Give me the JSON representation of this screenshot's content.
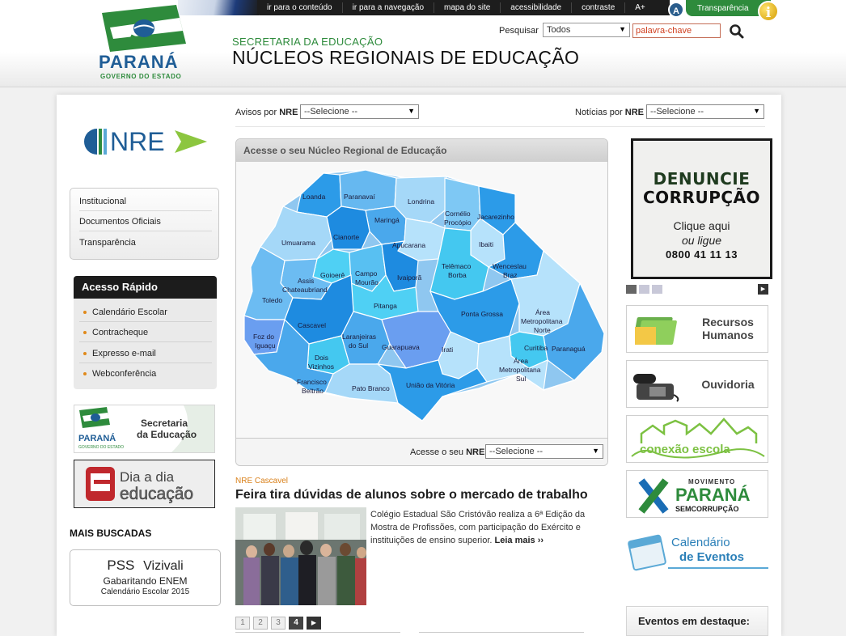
{
  "topbar": {
    "links": [
      "ir para o conteúdo",
      "ir para a navegação",
      "mapa do site",
      "acessibilidade",
      "contraste",
      "A+"
    ],
    "transparencia": "Transparência",
    "accessibility_icon_letter": "A",
    "info_icon_letter": "i"
  },
  "logo": {
    "word": "PARANÁ",
    "sub": "GOVERNO DO ESTADO"
  },
  "header": {
    "secretaria": "SECRETARIA DA EDUCAÇÃO",
    "title": "NÚCLEOS REGIONAIS DE EDUCAÇÃO",
    "search_label": "Pesquisar",
    "search_select": "Todos",
    "search_placeholder": "palavra-chave"
  },
  "sidebar": {
    "nre_logo_text": "NRE",
    "nav": [
      "Institucional",
      "Documentos Oficiais",
      "Transparência"
    ],
    "quick_access_title": "Acesso Rápido",
    "quick_access": [
      "Calendário Escolar",
      "Contracheque",
      "Expresso e-mail",
      "Webconferência"
    ],
    "banner_sec": {
      "brand": "PARANÁ",
      "sub": "GOVERNO DO ESTADO",
      "line1": "Secretaria",
      "line2": "da Educação"
    },
    "banner_dia": {
      "line1": "Dia a dia",
      "line2": "educação"
    },
    "mais_buscadas_title": "MAIS BUSCADAS",
    "mais_buscadas": {
      "pss": "PSS",
      "vizivali": "Vizivali",
      "gabaritando": "Gabaritando ENEM",
      "calendario": "Calendário Escolar 2015"
    }
  },
  "filters": {
    "avisos_label": "Avisos por ",
    "avisos_bold": "NRE",
    "noticias_label": "Notícias por ",
    "noticias_bold": "NRE",
    "select_default": "--Selecione --"
  },
  "map": {
    "title": "Acesse o seu Núcleo Regional de Educação",
    "footer_label": "Acesse o seu ",
    "footer_bold": "NRE",
    "footer_select": "--Selecione --",
    "regions": {
      "loanda": "Loanda",
      "paranavai": "Paranavaí",
      "londrina": "Londrina",
      "cornelio1": "Cornélio",
      "cornelio2": "Procópio",
      "jacarezinho": "Jacarezinho",
      "maringa": "Maringá",
      "umuarama": "Umuarama",
      "cianorte": "Cianorte",
      "apucarana": "Apucarana",
      "ibaiti": "Ibaiti",
      "goioere": "Goioerê",
      "campo1": "Campo",
      "campo2": "Mourão",
      "assis1": "Assis",
      "assis2": "Chateaubriand",
      "ivaipora": "Ivaiporã",
      "telemaco1": "Telêmaco",
      "telemaco2": "Borba",
      "wenceslau1": "Wenceslau",
      "wenceslau2": "Braz",
      "toledo": "Toledo",
      "pitanga": "Pitanga",
      "pontagrossa": "Ponta Grossa",
      "amn1": "Área",
      "amn2": "Metropolitana",
      "amn3": "Norte",
      "cascavel": "Cascavel",
      "foz1": "Foz do",
      "foz2": "Iguaçu",
      "laranjeiras1": "Laranjeiras",
      "laranjeiras2": "do Sul",
      "guarapuava": "Guarapuava",
      "irati": "Irati",
      "curitiba": "Curitiba",
      "paranagua": "Paranaguá",
      "dois1": "Dois",
      "dois2": "Vizinhos",
      "ams1": "Área",
      "ams2": "Metropolitana",
      "ams3": "Sul",
      "francisco1": "Francisco",
      "francisco2": "Beltrão",
      "patobranco": "Pato Branco",
      "uniao": "União da Vitória"
    }
  },
  "news": {
    "category": "NRE Cascavel",
    "title": "Feira tira dúvidas de alunos sobre o mercado de trabalho",
    "text": "Colégio Estadual São Cristóvão realiza a 6ª Edição da Mostra de Profissões, com participação do Exército e instituições de ensino superior.",
    "more": "Leia mais ››",
    "pages": [
      "1",
      "2",
      "3",
      "4"
    ],
    "next": "▶"
  },
  "right": {
    "denuncie": {
      "line1": "DENUNCIE",
      "line2": "CORRUPÇÃO",
      "line3": "Clique aqui",
      "line4": "ou ligue",
      "phone": "0800 41 11 13"
    },
    "slide_next": "▶",
    "recursos": {
      "line1": "Recursos",
      "line2": "Humanos"
    },
    "ouvidoria": "Ouvidoria",
    "conexao": "conexão escola",
    "movimento": {
      "top": "MOVIMENTO",
      "main": "PARANÁ",
      "sub": "SEMCORRUPÇÃO"
    },
    "calendario_eventos": {
      "line1": "Calendário",
      "line2": "de Eventos"
    },
    "eventos_title": "Eventos em destaque:"
  },
  "colors": {
    "green": "#2e8b3c",
    "blue": "#1f5d96",
    "orange": "#d9801a",
    "dark": "#1c1c1c"
  }
}
